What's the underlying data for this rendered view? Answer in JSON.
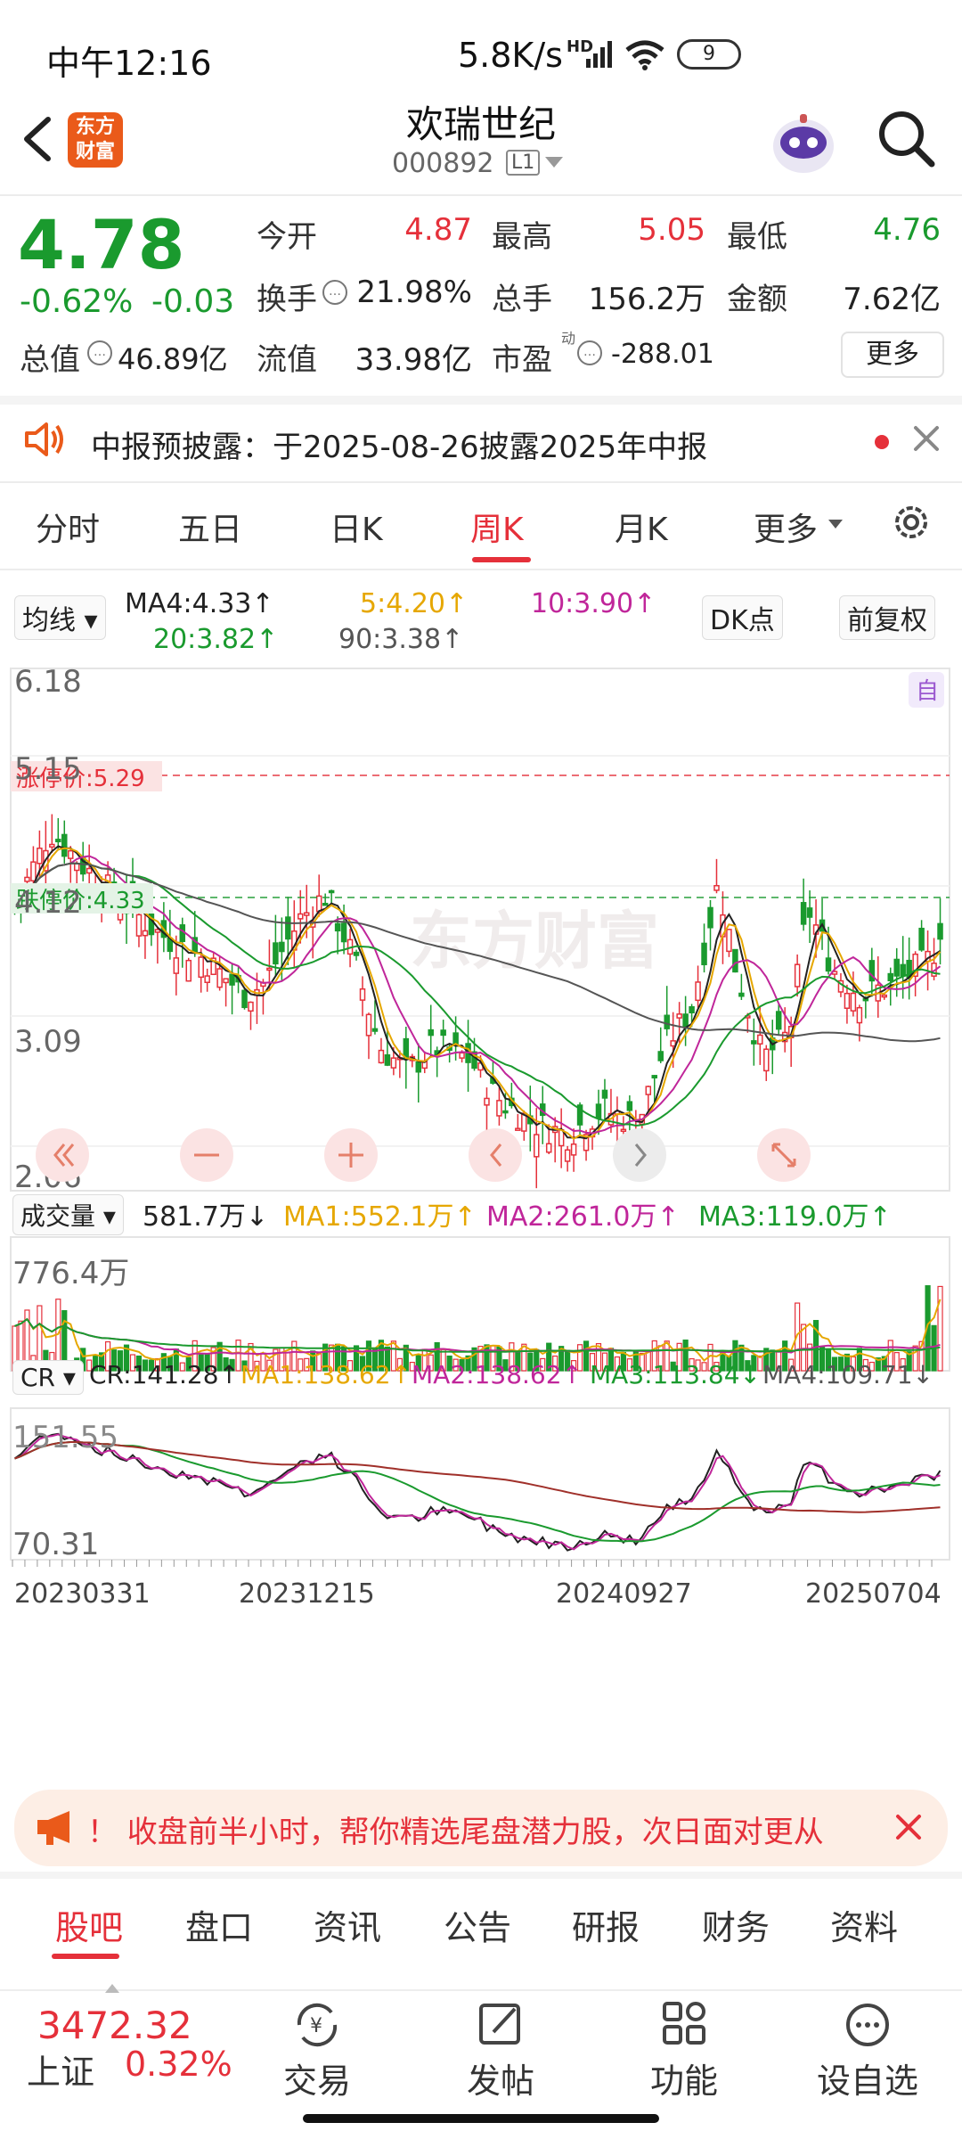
{
  "status_bar": {
    "time": "中午12:16",
    "net_rate": "5.8K/s",
    "hd": "HD",
    "battery": "9"
  },
  "header": {
    "logo_text": "东方财富",
    "stock_name": "欢瑞世纪",
    "stock_code": "000892",
    "level": "L1"
  },
  "quote": {
    "price": "4.78",
    "change_pct": "-0.62%",
    "change": "-0.03",
    "rows": [
      [
        {
          "label": "今开",
          "value": "4.87",
          "color": "red"
        },
        {
          "label": "最高",
          "value": "5.05",
          "color": "red"
        },
        {
          "label": "最低",
          "value": "4.76",
          "color": "green"
        }
      ],
      [
        {
          "label": "换手",
          "value": "21.98%",
          "color": "black"
        },
        {
          "label": "总手",
          "value": "156.2万",
          "color": "black"
        },
        {
          "label": "金额",
          "value": "7.62亿",
          "color": "black"
        }
      ],
      [
        {
          "label": "总值",
          "value": "46.89亿",
          "color": "black"
        },
        {
          "label": "流值",
          "value": "33.98亿",
          "color": "black"
        },
        {
          "label": "市盈",
          "value": "-288.01",
          "color": "black"
        }
      ]
    ],
    "pe_superscript": "动",
    "more_label": "更多"
  },
  "notice": {
    "text": "中报预披露：于2025-08-26披露2025年中报"
  },
  "chart_tabs": [
    {
      "label": "分时",
      "active": false
    },
    {
      "label": "五日",
      "active": false
    },
    {
      "label": "日K",
      "active": false
    },
    {
      "label": "周K",
      "active": true
    },
    {
      "label": "月K",
      "active": false
    },
    {
      "label": "更多",
      "active": false
    }
  ],
  "kline": {
    "indicator_select": "均线",
    "ma_labels": [
      {
        "text": "MA4:4.33↑",
        "color": "#222222"
      },
      {
        "text": "5:4.20↑",
        "color": "#e6a700"
      },
      {
        "text": "10:3.90↑",
        "color": "#c0269a"
      },
      {
        "text": "20:3.82↑",
        "color": "#1a9a2e"
      },
      {
        "text": "90:3.38↑",
        "color": "#555555"
      }
    ],
    "dk_button": "DK点",
    "adjust_button": "前复权",
    "auto_tag": "自",
    "y_ticks": [
      "6.18",
      "5.15",
      "4.12",
      "3.09",
      "2.06"
    ],
    "limit_up": "涨停价:5.29",
    "limit_down": "跌停价:4.33",
    "watermark": "东方财富"
  },
  "volume": {
    "indicator": "成交量",
    "value": "581.7万↓",
    "ma_labels": [
      {
        "text": "MA1:552.1万↑",
        "color": "#e6a700"
      },
      {
        "text": "MA2:261.0万↑",
        "color": "#c0269a"
      },
      {
        "text": "MA3:119.0万↑",
        "color": "#1a9a2e"
      }
    ],
    "max_label": "776.4万"
  },
  "cr": {
    "indicator": "CR",
    "labels": [
      {
        "text": "CR:141.28↑",
        "color": "#222222"
      },
      {
        "text": "MA1:138.62↑",
        "color": "#e6a700"
      },
      {
        "text": "MA2:138.62↑",
        "color": "#c0269a"
      },
      {
        "text": "MA3:113.84↓",
        "color": "#1a9a2e"
      },
      {
        "text": "MA4:109.71↓",
        "color": "#555555"
      }
    ],
    "y_top": "151.55",
    "y_bottom": "70.31"
  },
  "x_dates": [
    "20230331",
    "20231215",
    "20240927",
    "20250704"
  ],
  "promo": {
    "text": "！ 收盘前半小时，帮你精选尾盘潜力股，次日面对更从"
  },
  "bottom_tabs": [
    {
      "label": "股吧",
      "active": true
    },
    {
      "label": "盘口",
      "active": false
    },
    {
      "label": "资讯",
      "active": false
    },
    {
      "label": "公告",
      "active": false
    },
    {
      "label": "研报",
      "active": false
    },
    {
      "label": "财务",
      "active": false
    },
    {
      "label": "资料",
      "active": false
    }
  ],
  "bottom_nav": {
    "index_value": "3472.32",
    "index_name": "上证",
    "index_pct": "0.32%",
    "items": [
      {
        "label": "交易",
        "icon": "yuan-exchange-icon"
      },
      {
        "label": "发帖",
        "icon": "edit-post-icon"
      },
      {
        "label": "功能",
        "icon": "grid-icon"
      },
      {
        "label": "设自选",
        "icon": "more-dots-icon"
      }
    ]
  },
  "colors": {
    "up": "#e5303a",
    "down": "#1a9a2e",
    "accent": "#e5303a"
  }
}
